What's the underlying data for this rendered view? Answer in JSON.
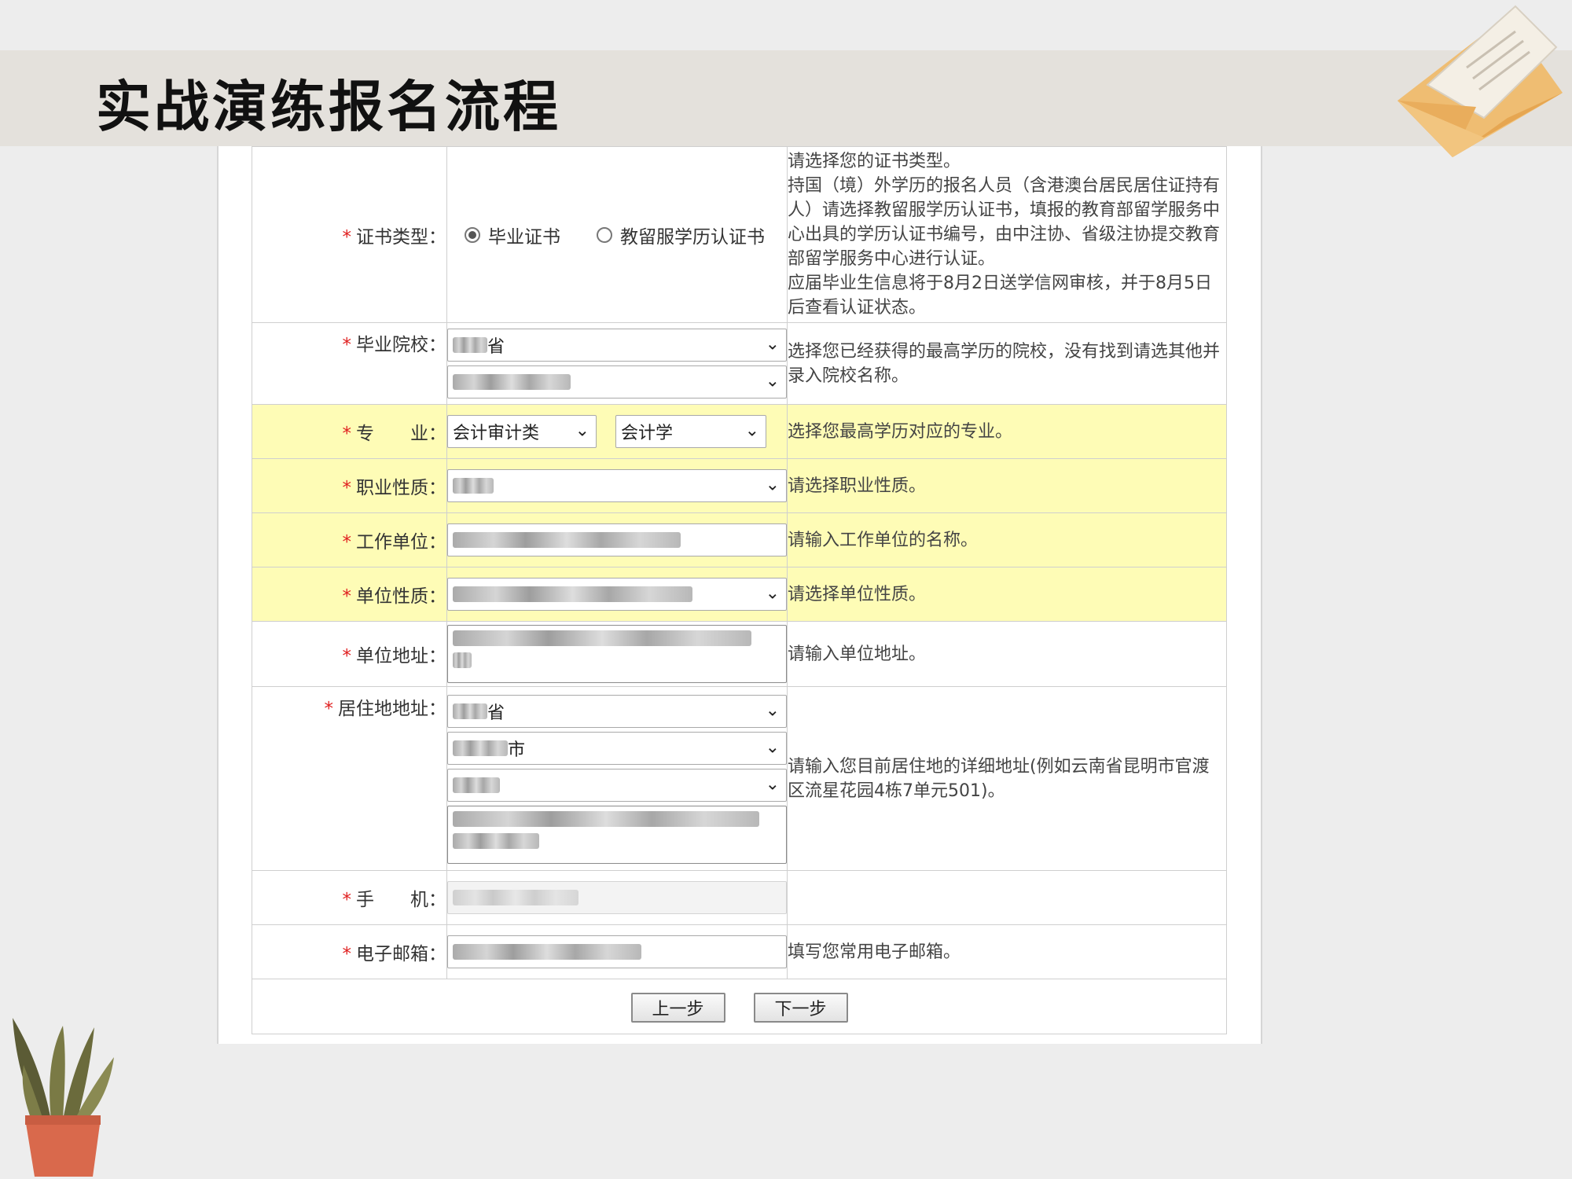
{
  "slide": {
    "title": "实战演练报名流程"
  },
  "form": {
    "cert_type": {
      "label": "证书类型：",
      "options": [
        "毕业证书",
        "教留服学历认证书"
      ],
      "selected": "毕业证书",
      "help": "请选择您的证书类型。\n持国（境）外学历的报名人员（含港澳台居民居住证持有人）请选择教留服学历认证书，填报的教育部留学服务中心出具的学历认证书编号，由中注协、省级注协提交教育部留学服务中心进行认证。\n应届毕业生信息将于8月2日送学信网审核，并于8月5日后查看认证状态。"
    },
    "school": {
      "label": "毕业院校：",
      "province": "省",
      "school_name": "",
      "help": "选择您已经获得的最高学历的院校，没有找到请选其他并录入院校名称。"
    },
    "major": {
      "label": "专　　业：",
      "category": "会计审计类",
      "major": "会计学",
      "help": "选择您最高学历对应的专业。"
    },
    "occupation": {
      "label": "职业性质：",
      "value": "",
      "help": "请选择职业性质。"
    },
    "employer": {
      "label": "工作单位：",
      "value": "",
      "help": "请输入工作单位的名称。"
    },
    "employer_type": {
      "label": "单位性质：",
      "value": "",
      "help": "请选择单位性质。"
    },
    "employer_address": {
      "label": "单位地址：",
      "value": "",
      "help": "请输入单位地址。"
    },
    "residence": {
      "label": "居住地地址：",
      "province": "省",
      "city": "市",
      "district": "",
      "detail": "",
      "help": "请输入您目前居住地的详细地址(例如云南省昆明市官渡区流星花园4栋7单元501)。"
    },
    "mobile": {
      "label": "手　　机：",
      "value": ""
    },
    "email": {
      "label": "电子邮箱：",
      "value": "",
      "help": "填写您常用电子邮箱。"
    },
    "buttons": {
      "prev": "上一步",
      "next": "下一步"
    }
  },
  "colors": {
    "highlight_row": "#fefcb6",
    "required_mark": "#e02020",
    "title_band": "#e4e1dc",
    "envelope": "#efbd72",
    "plant_pot": "#d9694c"
  },
  "decor": {
    "top_right": "envelope-icon",
    "bottom_left": "potted-plant-icon"
  }
}
